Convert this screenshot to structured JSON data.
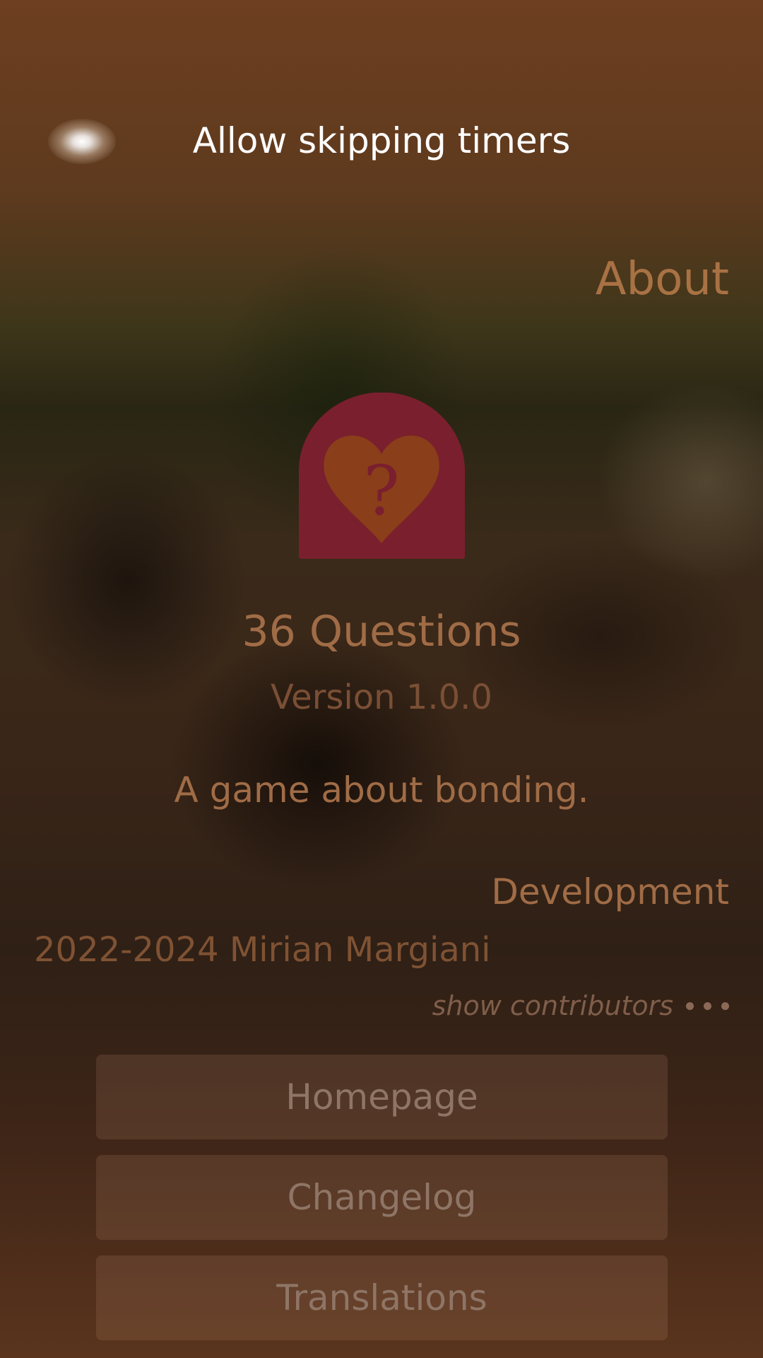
{
  "pulley_menu": {
    "item_label": "Allow skipping timers"
  },
  "page": {
    "header": "About"
  },
  "app": {
    "icon": "heart-question-icon",
    "name": "36 Questions",
    "version": "Version 1.0.0",
    "description": "A game about bonding."
  },
  "development": {
    "section_header": "Development",
    "author": "2022-2024 Mirian Margiani",
    "show_contributors_label": "show contributors"
  },
  "buttons": {
    "homepage": "Homepage",
    "changelog": "Changelog",
    "translations": "Translations"
  },
  "colors": {
    "highlight": "#a97244",
    "icon_background": "#7a1f2e",
    "icon_heart": "#8a3e1a"
  }
}
